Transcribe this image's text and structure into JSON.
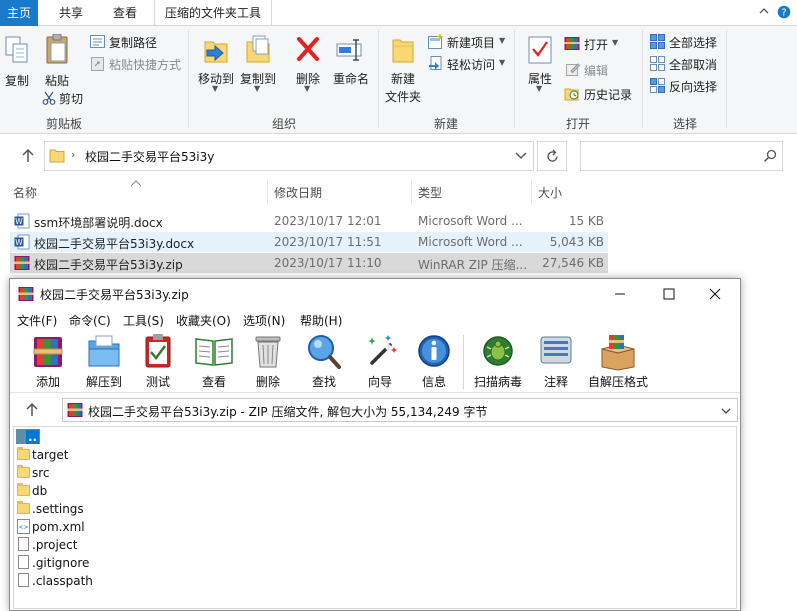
{
  "explorer": {
    "tabs": [
      "主页",
      "共享",
      "查看",
      "压缩的文件夹工具"
    ],
    "ribbon": {
      "clipboard": {
        "copy": "复制",
        "paste": "粘贴",
        "copy_path": "复制路径",
        "paste_shortcut": "粘贴快捷方式",
        "cut": "剪切",
        "label": "剪贴板"
      },
      "organize": {
        "move_to": "移动到",
        "copy_to": "复制到",
        "delete": "删除",
        "rename": "重命名",
        "label": "组织"
      },
      "new": {
        "new_folder_line1": "新建",
        "new_folder_line2": "文件夹",
        "new_item": "新建项目",
        "easy_access": "轻松访问",
        "label": "新建"
      },
      "open": {
        "properties": "属性",
        "open": "打开",
        "edit": "编辑",
        "history": "历史记录",
        "label": "打开"
      },
      "select": {
        "select_all": "全部选择",
        "select_none": "全部取消",
        "invert": "反向选择",
        "label": "选择"
      }
    },
    "address": {
      "path": "校园二手交易平台53i3y",
      "search_placeholder": ""
    },
    "columns": [
      "名称",
      "修改日期",
      "类型",
      "大小"
    ],
    "files": [
      {
        "name": "ssm环境部署说明.docx",
        "date": "2023/10/17 12:01",
        "type": "Microsoft Word ...",
        "size": "15 KB",
        "icon": "word-doc-icon"
      },
      {
        "name": "校园二手交易平台53i3y.docx",
        "date": "2023/10/17 11:51",
        "type": "Microsoft Word ...",
        "size": "5,043 KB",
        "icon": "word-doc-icon"
      },
      {
        "name": "校园二手交易平台53i3y.zip",
        "date": "2023/10/17 11:10",
        "type": "WinRAR ZIP 压缩...",
        "size": "27,546 KB",
        "icon": "winrar-zip-icon"
      }
    ]
  },
  "winrar": {
    "title": "校园二手交易平台53i3y.zip",
    "menu": [
      "文件(F)",
      "命令(C)",
      "工具(S)",
      "收藏夹(O)",
      "选项(N)",
      "帮助(H)"
    ],
    "toolbar": [
      "添加",
      "解压到",
      "测试",
      "查看",
      "删除",
      "查找",
      "向导",
      "信息",
      "扫描病毒",
      "注释",
      "自解压格式"
    ],
    "path_text": "校园二手交易平台53i3y.zip - ZIP 压缩文件, 解包大小为 55,134,249 字节",
    "items": [
      {
        "name": "..",
        "kind": "up"
      },
      {
        "name": "target",
        "kind": "folder"
      },
      {
        "name": "src",
        "kind": "folder"
      },
      {
        "name": "db",
        "kind": "folder"
      },
      {
        "name": ".settings",
        "kind": "folder"
      },
      {
        "name": "pom.xml",
        "kind": "xml"
      },
      {
        "name": ".project",
        "kind": "file"
      },
      {
        "name": ".gitignore",
        "kind": "file"
      },
      {
        "name": ".classpath",
        "kind": "file"
      }
    ]
  },
  "colors": {
    "accent": "#1979ca",
    "selection_light": "#e5f1fb",
    "selection_gray": "#d9d9d9",
    "delete_red": "#e02424"
  }
}
